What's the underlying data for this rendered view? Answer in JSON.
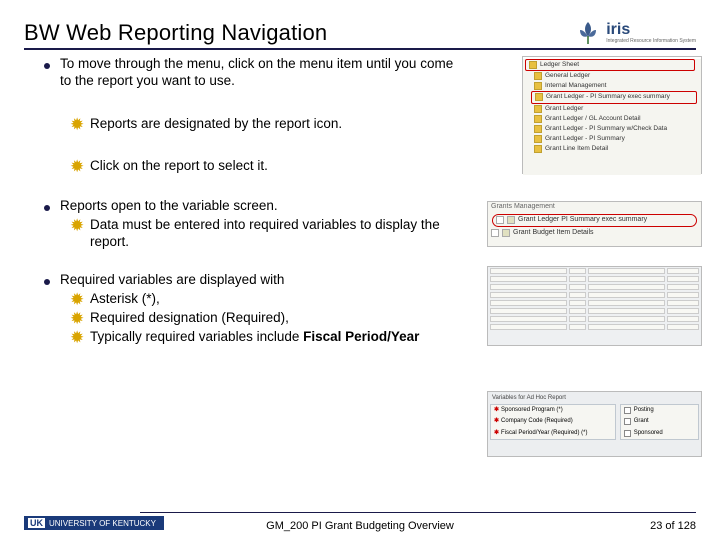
{
  "title": "BW Web Reporting Navigation",
  "logo": {
    "text": "iris",
    "sub": "Integrated Resource Information System"
  },
  "bullets": [
    {
      "text": "To move through the menu, click on the menu item until you come to the report you want to use.",
      "subs": [
        "Reports are designated by the report icon.",
        "Click on the report to select it."
      ]
    },
    {
      "text": "Reports open to the variable screen.",
      "subs": [
        "Data must be entered into required variables to display the report."
      ]
    },
    {
      "text": "Required variables are displayed with",
      "subs": [
        "Asterisk (*),",
        "Required designation (Required),",
        "Typically required variables include "
      ],
      "trailing_bold": "Fiscal Period/Year"
    }
  ],
  "thumb1": {
    "title": "Ledger Sheet",
    "lines": [
      "General Ledger",
      "Internal Management",
      "Grant Ledger - PI Summary exec summary",
      "Grant Ledger",
      "Grant Ledger / GL Account Detail",
      "Grant Ledger - PI Summary w/Check Data",
      "Grant Ledger - PI Summary",
      "Grant Line Item Detail"
    ]
  },
  "thumb2": {
    "header": "Grants Management",
    "selected": "Grant Ledger PI Summary exec summary",
    "other": "Grant Budget Item Details"
  },
  "thumb4": {
    "title": "Variables for Ad Hoc Report",
    "left": [
      "Sponsored Program (*)",
      "Company Code (Required)",
      "Fiscal Period/Year (Required) (*)"
    ],
    "right": [
      "Posting",
      "Grant",
      "Sponsored"
    ]
  },
  "footer": {
    "org": "UNIVERSITY OF KENTUCKY",
    "center": "GM_200 PI Grant Budgeting Overview",
    "right": "23 of 128"
  }
}
